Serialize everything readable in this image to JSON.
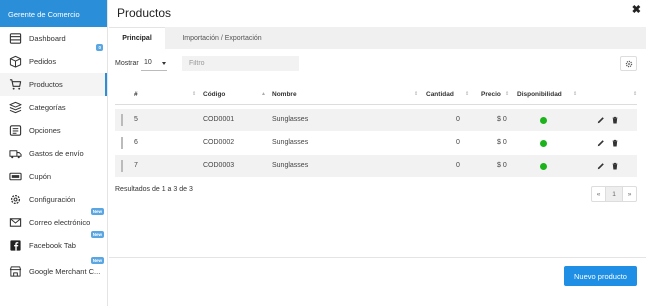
{
  "sidebar": {
    "header": "Gerente de Comercio",
    "items": [
      {
        "label": "Dashboard",
        "icon": "dashboard-icon"
      },
      {
        "label": "Pedidos",
        "icon": "box-icon",
        "badge": "0"
      },
      {
        "label": "Productos",
        "icon": "cart-icon",
        "active": true
      },
      {
        "label": "Categorías",
        "icon": "categories-icon"
      },
      {
        "label": "Opciones",
        "icon": "options-icon"
      },
      {
        "label": "Gastos de envío",
        "icon": "truck-icon"
      },
      {
        "label": "Cupón",
        "icon": "coupon-icon"
      },
      {
        "label": "Configuración",
        "icon": "gear-icon"
      },
      {
        "label": "Correo electrónico",
        "icon": "mail-icon",
        "badge": "New"
      },
      {
        "label": "Facebook Tab",
        "icon": "facebook-icon",
        "badge": "New"
      },
      {
        "label": "Google Merchant C...",
        "icon": "store-icon",
        "badge": "New"
      }
    ]
  },
  "main": {
    "title": "Productos",
    "close_icon": "close-icon",
    "tabs": [
      {
        "label": "Principal",
        "active": true
      },
      {
        "label": "Importación / Exportación",
        "active": false
      }
    ],
    "show_label": "Mostrar",
    "page_size": "10",
    "filter_placeholder": "Filtro",
    "table": {
      "columns": [
        "#",
        "Código",
        "Nombre",
        "Cantidad",
        "Precio",
        "Disponibilidad"
      ],
      "rows": [
        {
          "id": "5",
          "code": "COD0001",
          "name": "Sunglasses",
          "qty": "0",
          "price": "$ 0",
          "available": true
        },
        {
          "id": "6",
          "code": "COD0002",
          "name": "Sunglasses",
          "qty": "0",
          "price": "$ 0",
          "available": true
        },
        {
          "id": "7",
          "code": "COD0003",
          "name": "Sunglasses",
          "qty": "0",
          "price": "$ 0",
          "available": true
        }
      ]
    },
    "results_text": "Resultados de 1 a 3 de 3",
    "pagination": {
      "prev": "«",
      "current": "1",
      "next": "»"
    },
    "primary_button": "Nuevo producto",
    "colors": {
      "accent": "#1e8fe4",
      "header": "#2a8fd8",
      "available": "#1db31d"
    }
  }
}
